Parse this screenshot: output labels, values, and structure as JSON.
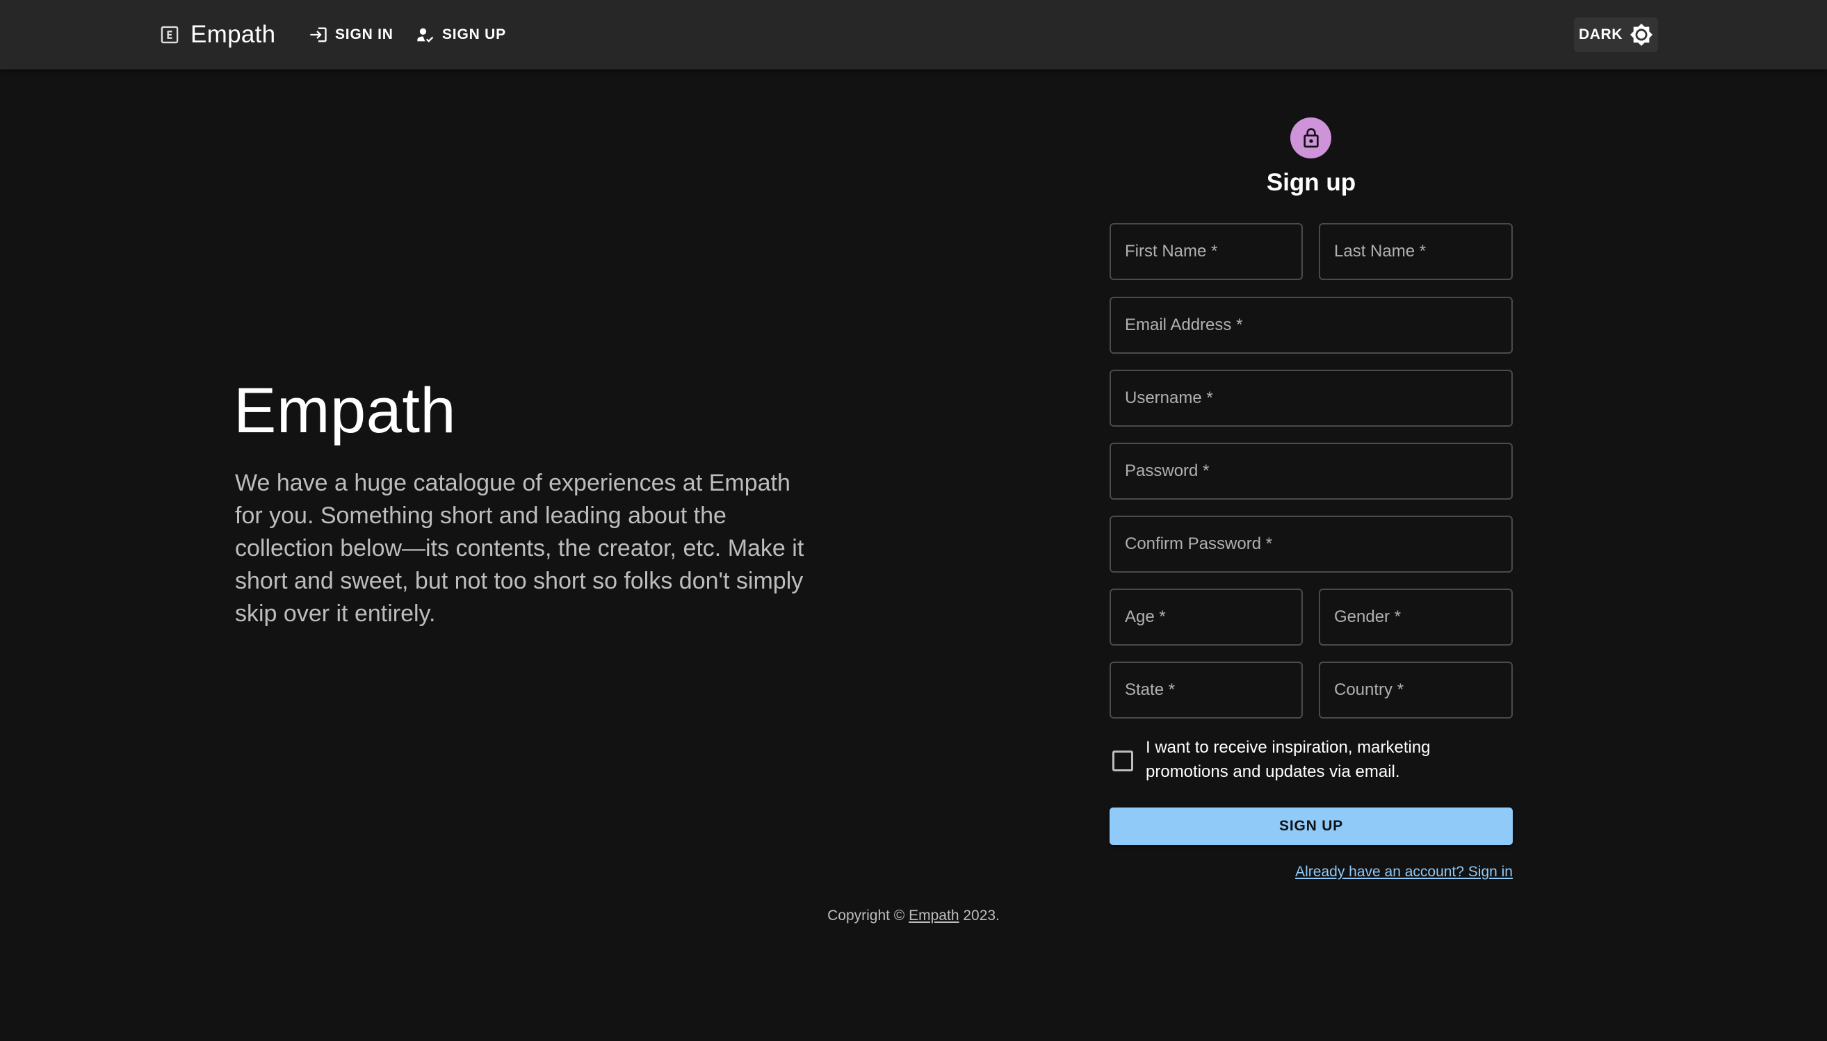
{
  "appbar": {
    "brand": "Empath",
    "nav": [
      {
        "label": "SIGN IN",
        "icon": "login-icon"
      },
      {
        "label": "SIGN UP",
        "icon": "person-add-icon"
      }
    ],
    "theme_toggle": {
      "label": "DARK",
      "icon": "brightness-icon"
    }
  },
  "hero": {
    "title": "Empath",
    "description": "We have a huge catalogue of experiences at Empath for you. Something short and leading about the collection below—its contents, the creator, etc. Make it short and sweet, but not too short so folks don't simply skip over it entirely."
  },
  "form": {
    "title": "Sign up",
    "lock_icon": "lock-icon",
    "fields": {
      "first_name": "First Name *",
      "last_name": "Last Name *",
      "email": "Email Address *",
      "username": "Username *",
      "password": "Password *",
      "confirm_password": "Confirm Password *",
      "age": "Age *",
      "gender": "Gender *",
      "state": "State *",
      "country": "Country *"
    },
    "marketing_checkbox": {
      "label": "I want to receive inspiration, marketing promotions and updates via email.",
      "checked": false
    },
    "submit_label": "SIGN UP",
    "signin_link": "Already have an account? Sign in"
  },
  "footer": {
    "prefix": "Copyright ©",
    "link": "Empath",
    "suffix": "2023."
  },
  "colors": {
    "background": "#121212",
    "appbar": "#272727",
    "accent": "#90caf9",
    "avatar": "#ce93d8"
  }
}
